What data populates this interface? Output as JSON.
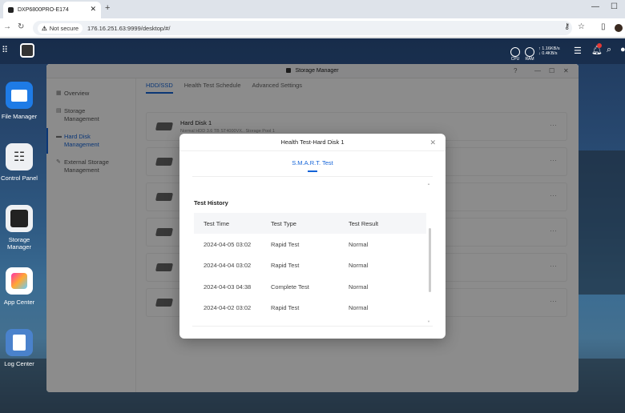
{
  "browser": {
    "tab_title": "DXP6800PRO-E174",
    "not_secure": "Not secure",
    "url": "176.16.251.63:9999/desktop/#/"
  },
  "topbar": {
    "cpu": "CPU",
    "ram": "RAM",
    "net_up": "↑ 1.16KB/s",
    "net_down": "↓ 0.4KB/s"
  },
  "apps": [
    {
      "label": "File Manager"
    },
    {
      "label": "Control Panel"
    },
    {
      "label": "Storage Manager"
    },
    {
      "label": "App Center"
    },
    {
      "label": "Log Center"
    }
  ],
  "window": {
    "title": "Storage Manager",
    "sidebar": [
      {
        "label": "Overview"
      },
      {
        "label": "Storage\nManagement"
      },
      {
        "label": "Hard Disk\nManagement"
      },
      {
        "label": "External Storage\nManagement"
      }
    ],
    "tabs": [
      "HDD/SSD",
      "Health Test Schedule",
      "Advanced Settings"
    ],
    "disk1": {
      "name": "Hard Disk 1",
      "info": "Normal   HDD   3.6 TB   ST4000VX..   Storage Pool 1"
    }
  },
  "dialog": {
    "title": "Health Test-Hard Disk 1",
    "tab": "S.M.A.R.T. Test",
    "history_title": "Test History",
    "columns": [
      "Test Time",
      "Test Type",
      "Test Result"
    ],
    "rows": [
      [
        "2024-04-05 03:02",
        "Rapid Test",
        "Normal"
      ],
      [
        "2024-04-04 03:02",
        "Rapid Test",
        "Normal"
      ],
      [
        "2024-04-03 04:38",
        "Complete Test",
        "Normal"
      ],
      [
        "2024-04-02 03:02",
        "Rapid Test",
        "Normal"
      ]
    ]
  }
}
